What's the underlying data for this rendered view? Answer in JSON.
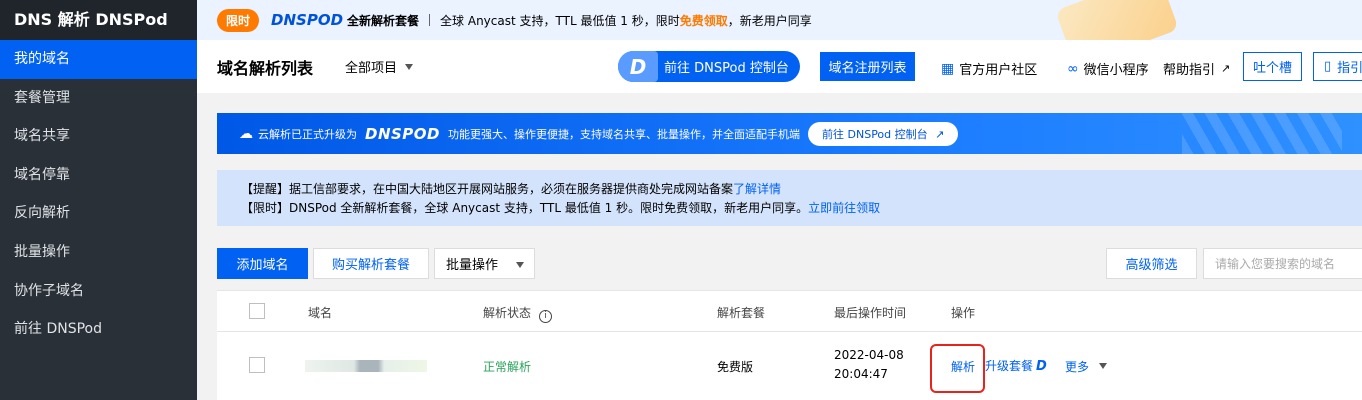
{
  "sidebar": {
    "title": "DNS 解析 DNSPod",
    "items": [
      {
        "label": "我的域名",
        "active": true
      },
      {
        "label": "套餐管理"
      },
      {
        "label": "域名共享"
      },
      {
        "label": "域名停靠"
      },
      {
        "label": "反向解析"
      },
      {
        "label": "批量操作"
      },
      {
        "label": "协作子域名"
      },
      {
        "label": "前往 DNSPod"
      }
    ]
  },
  "promo": {
    "tag": "限时",
    "logo": "DNSPOD",
    "package": "全新解析套餐",
    "text1": "全球 Anycast 支持，TTL 最低值 1 秒，限时",
    "highlight": "免费领取",
    "text2": "，新老用户同享"
  },
  "header": {
    "title": "域名解析列表",
    "project": "全部项目",
    "console_badge": "D",
    "console_button": "前往 DNSPod 控制台",
    "register_button": "域名注册列表",
    "community": "官方用户社区",
    "mini_program": "微信小程序",
    "help": "帮助指引",
    "feedback": "吐个槽",
    "guide": "指引"
  },
  "banner": {
    "text1": "云解析已正式升级为",
    "logo": "DNSPOD",
    "text2": "功能更强大、操作更便捷，支持域名共享、批量操作，并全面适配手机端",
    "button": "前往 DNSPod 控制台"
  },
  "notice": {
    "line1_text": "【提醒】据工信部要求，在中国大陆地区开展网站服务，必须在服务器提供商处完成网站备案",
    "line1_link": "了解详情",
    "line2_text": "【限时】DNSPod 全新解析套餐，全球 Anycast 支持，TTL 最低值 1 秒。限时免费领取，新老用户同享。",
    "line2_link": "立即前往领取"
  },
  "toolbar": {
    "add_domain": "添加域名",
    "buy_package": "购买解析套餐",
    "batch": "批量操作",
    "advanced_filter": "高级筛选",
    "search_placeholder": "请输入您要搜索的域名"
  },
  "table": {
    "columns": {
      "domain": "域名",
      "status": "解析状态",
      "package": "解析套餐",
      "last_op": "最后操作时间",
      "actions": "操作"
    },
    "rows": [
      {
        "status": "正常解析",
        "package": "免费版",
        "date": "2022-04-08",
        "time": "20:04:47",
        "action_resolve": "解析",
        "action_upgrade": "升级套餐",
        "action_more": "更多"
      }
    ]
  },
  "colors": {
    "primary": "#0061f2",
    "sidebar_bg": "#293038",
    "status_ok": "#29a35a",
    "promo_orange": "#ff7a00",
    "highlight_red": "#e8231e"
  }
}
